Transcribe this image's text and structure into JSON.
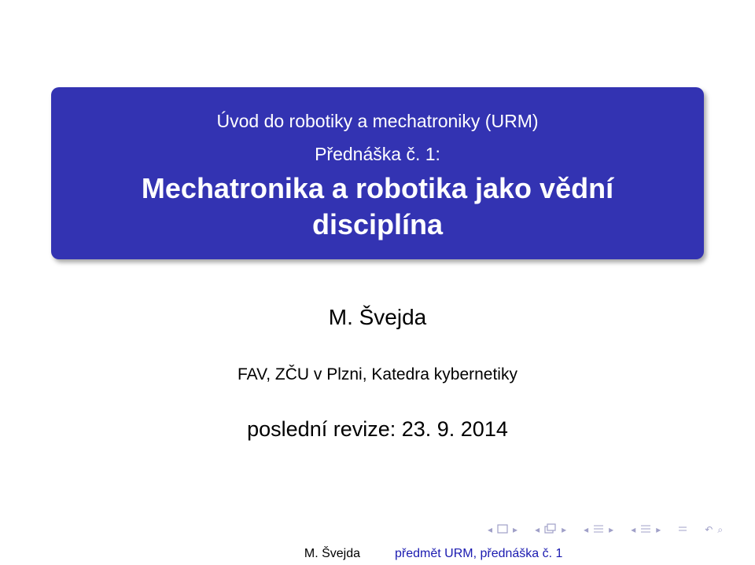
{
  "title_box": {
    "course": "Úvod do robotiky a mechatroniky (URM)",
    "lecture": "Přednáška č. 1:",
    "title_line1": "Mechatronika a robotika jako vědní",
    "title_line2": "disciplína"
  },
  "author": "M. Švejda",
  "institute": "FAV, ZČU v Plzni, Katedra kybernetiky",
  "date": "poslední revize: 23. 9. 2014",
  "navigation": {
    "icons": [
      "nav-prev-arrow-icon",
      "slide-icon",
      "nav-next-arrow-icon",
      "nav-prev-arrow-icon",
      "frame-icon",
      "nav-next-arrow-icon",
      "nav-prev-arrow-icon",
      "section-icon",
      "nav-next-arrow-icon",
      "nav-prev-arrow-icon",
      "subsection-icon",
      "nav-next-arrow-icon",
      "align-icon",
      "back-icon",
      "zoom-search-icon"
    ]
  },
  "footer": {
    "author": "M. Švejda",
    "subject": "předmět URM, přednáška č. 1"
  },
  "colors": {
    "title_box": "#3333b2",
    "footer_link": "#1a1ab0"
  }
}
